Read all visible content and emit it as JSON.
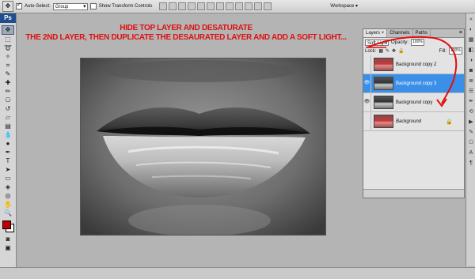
{
  "options_bar": {
    "auto_select_label": "Auto-Select:",
    "auto_select_value": "Group",
    "transform_label": "Show Transform Controls",
    "workspace_label": "Workspace"
  },
  "tools": {
    "logo": "Ps",
    "foreground_color": "#c00000",
    "background_color": "#ffffff"
  },
  "annotations": {
    "line1": "HIDE TOP LAYER AND DESATURATE",
    "line2": "THE 2ND LAYER, THEN DUPLICATE THE DESAURATED LAYER AND ADD A SOFT LIGHT...",
    "color": "#e01010"
  },
  "layers_panel": {
    "tabs": [
      "Layers ×",
      "Channels",
      "Paths"
    ],
    "blend_mode": "Soft Light",
    "opacity_label": "Opacity:",
    "opacity_value": "100%",
    "lock_label": "Lock:",
    "fill_label": "Fill:",
    "fill_value": "100%",
    "layers": [
      {
        "name": "Background copy 2",
        "visible": false,
        "thumb": "color"
      },
      {
        "name": "Background copy 3",
        "visible": true,
        "thumb": "gray",
        "active": true
      },
      {
        "name": "Background copy",
        "visible": true,
        "thumb": "gray"
      },
      {
        "name": "Background",
        "visible": false,
        "thumb": "color",
        "locked": true
      }
    ],
    "selection_color": "#3b8fe8"
  }
}
